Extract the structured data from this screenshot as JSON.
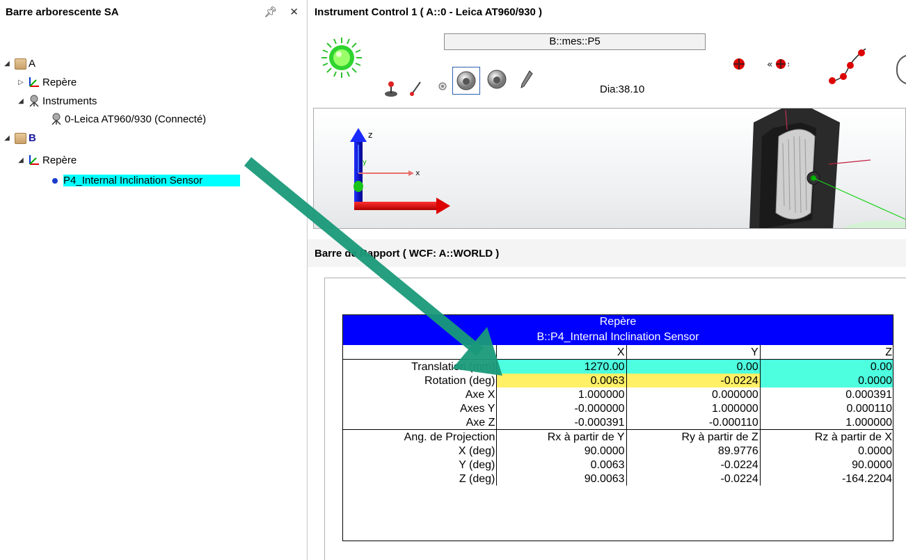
{
  "sidebar": {
    "title": "Barre arborescente SA",
    "pin_icon": "pin-icon",
    "close_icon": "close-icon",
    "tree": [
      {
        "label": "A",
        "icon": "box-icon",
        "expander": "expanded"
      },
      {
        "label": "Repère",
        "icon": "frame-icon",
        "expander": "collapsed"
      },
      {
        "label": "Instruments",
        "icon": "instrument-icon",
        "expander": "expanded"
      },
      {
        "label": "0-Leica AT960/930 (Connecté)",
        "icon": "instrument-icon"
      },
      {
        "label": "B",
        "icon": "box-icon",
        "expander": "expanded"
      },
      {
        "label": "Repère",
        "icon": "frame-icon",
        "expander": "expanded"
      },
      {
        "label": "P4_Internal Inclination Sensor",
        "icon": "point-icon",
        "selected": true
      }
    ]
  },
  "instrument": {
    "title": "Instrument Control 1 ( A::0 - Leica AT960/930 )",
    "measure_field": "B::mes::P5",
    "dia": "Dia:38.10"
  },
  "report": {
    "title": "Barre de Rapport ( WCF: A::WORLD )",
    "heading": "Repère",
    "subheading": "B::P4_Internal Inclination Sensor",
    "columns": [
      "X",
      "Y",
      "Z"
    ],
    "rows": [
      {
        "label": "Translation (mm)",
        "x": "1270.00",
        "y": "0.00",
        "z": "0.00"
      },
      {
        "label": "Rotation (deg)",
        "x": "0.0063",
        "y": "-0.0224",
        "z": "0.0000"
      },
      {
        "label": "Axe X",
        "x": "1.000000",
        "y": "0.000000",
        "z": "0.000391"
      },
      {
        "label": "Axes Y",
        "x": "-0.000000",
        "y": "1.000000",
        "z": "0.000110"
      },
      {
        "label": "Axe Z",
        "x": "-0.000391",
        "y": "-0.000110",
        "z": "1.000000"
      },
      {
        "label": "Ang. de Projection",
        "x": "Rx à partir de Y",
        "y": "Ry à partir de Z",
        "z": "Rz à partir de X"
      },
      {
        "label": "X (deg)",
        "x": "90.0000",
        "y": "89.9776",
        "z": "0.0000"
      },
      {
        "label": "Y (deg)",
        "x": "0.0063",
        "y": "-0.0224",
        "z": "90.0000"
      },
      {
        "label": "Z (deg)",
        "x": "90.0063",
        "y": "-0.0224",
        "z": "-164.2204"
      }
    ]
  },
  "colors": {
    "selection": "#00ffff",
    "report_title_bg": "#0000ff",
    "highlight_cyan": "#4dffdf",
    "highlight_yellow": "#fff066",
    "annotation_arrow": "#1a9a7a"
  }
}
